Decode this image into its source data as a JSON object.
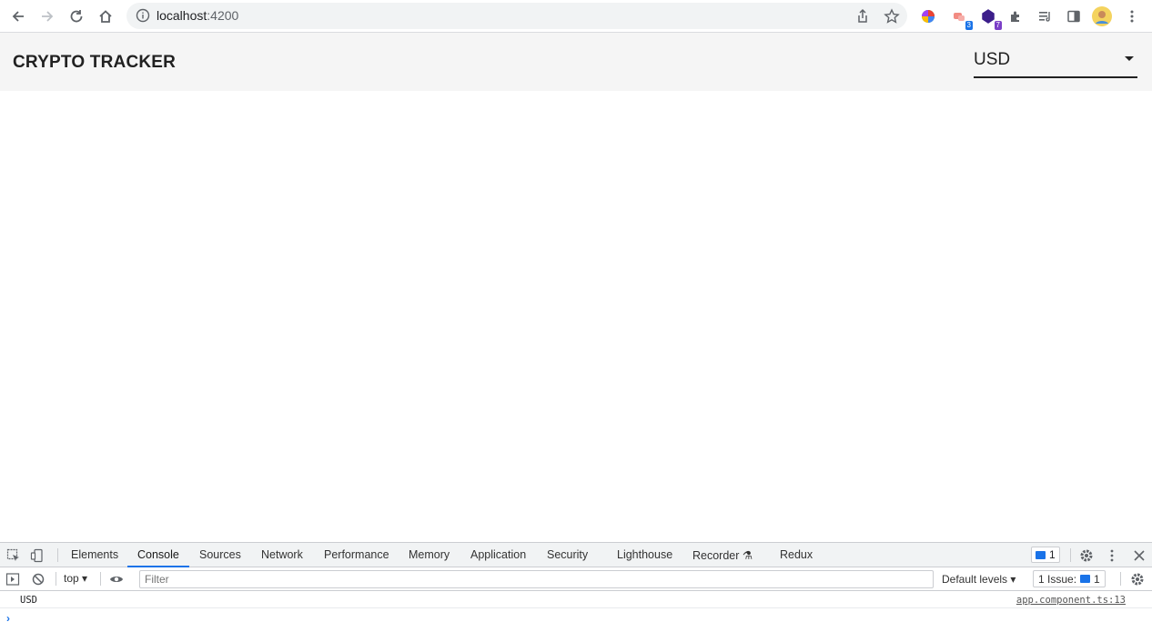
{
  "browser": {
    "url_host": "localhost",
    "url_port": ":4200",
    "extension_badges": [
      "3",
      "7"
    ]
  },
  "app": {
    "title": "CRYPTO TRACKER",
    "currency": {
      "selected": "USD"
    }
  },
  "devtools": {
    "tabs": [
      "Elements",
      "Console",
      "Sources",
      "Network",
      "Performance",
      "Memory",
      "Application",
      "Security",
      "Lighthouse",
      "Recorder",
      "Redux"
    ],
    "active_tab": "Console",
    "message_count": "1",
    "context": "top",
    "filter_placeholder": "Filter",
    "levels_label": "Default levels",
    "issues_label": "1 Issue:",
    "issues_count": "1",
    "console": {
      "message": "USD",
      "source": "app.component.ts:13"
    },
    "prompt_symbol": "›"
  },
  "colors": {
    "accent": "#1a73e8",
    "header_bg": "#f5f5f5"
  }
}
